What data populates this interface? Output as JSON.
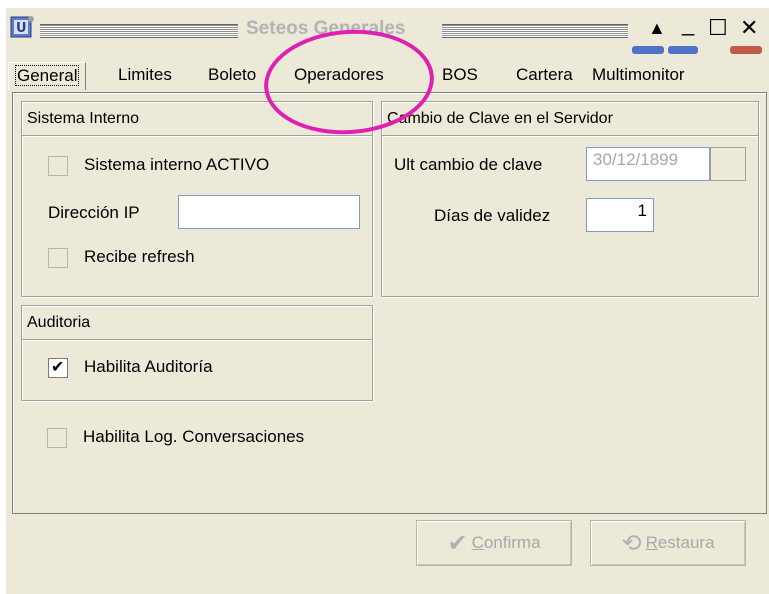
{
  "window": {
    "title": "Seteos Generales",
    "controls": {
      "restore": "▲",
      "minimize": "_",
      "maximize": "☐",
      "close": "✕"
    }
  },
  "tabs": [
    {
      "label": "General",
      "active": true
    },
    {
      "label": "Limites",
      "active": false
    },
    {
      "label": "Boleto",
      "active": false
    },
    {
      "label": "Operadores",
      "active": false
    },
    {
      "label": "BOS",
      "active": false
    },
    {
      "label": "Cartera",
      "active": false
    },
    {
      "label": "Multimonitor",
      "active": false
    }
  ],
  "sistema_interno": {
    "title": "Sistema Interno",
    "activo_label": "Sistema interno ACTIVO",
    "activo_checked": false,
    "ip_label": "Dirección IP",
    "ip_value": "",
    "refresh_label": "Recibe refresh",
    "refresh_checked": false
  },
  "cambio_clave": {
    "title": "Cambio de Clave en el Servidor",
    "ult_label": "Ult cambio de clave",
    "ult_value": "30/12/1899",
    "dias_label": "Días de validez",
    "dias_value": "1"
  },
  "auditoria": {
    "title": "Auditoria",
    "habilita_label": "Habilita Auditoría",
    "habilita_checked": true
  },
  "log": {
    "label": "Habilita Log. Conversaciones",
    "checked": false
  },
  "buttons": {
    "confirma_first": "C",
    "confirma_rest": "onfirma",
    "restaura_first": "R",
    "restaura_rest": "estaura"
  },
  "colors": {
    "annotation": "#e020b0",
    "window_bg": "#ece9d8"
  }
}
